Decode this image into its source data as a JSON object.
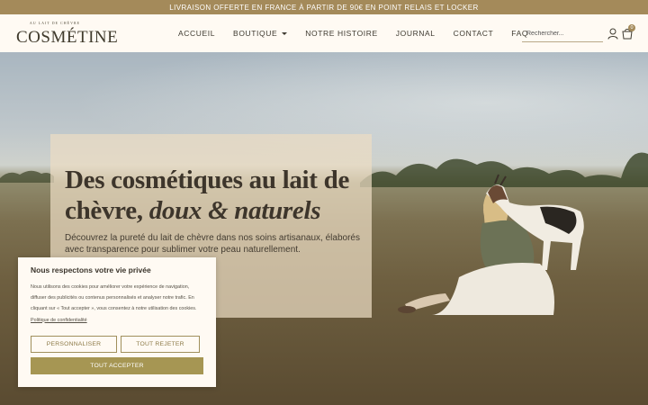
{
  "promo": {
    "text": "LIVRAISON OFFERTE EN FRANCE À PARTIR DE 90€ EN POINT RELAIS ET LOCKER"
  },
  "header": {
    "logo_tagline": "AU LAIT DE CHÈVRE",
    "logo_name": "COSMÉTINE",
    "nav": [
      {
        "label": "ACCUEIL"
      },
      {
        "label": "BOUTIQUE"
      },
      {
        "label": "NOTRE HISTOIRE"
      },
      {
        "label": "JOURNAL"
      },
      {
        "label": "CONTACT"
      },
      {
        "label": "FAQ"
      }
    ],
    "search_placeholder": "Rechercher...",
    "cart_count": "0"
  },
  "hero": {
    "title_line1": "Des cosmétiques au lait de",
    "title_line2_plain": "chèvre, ",
    "title_line2_italic": "doux & naturels",
    "subtitle": "Découvrez la pureté du lait de chèvre dans nos soins artisanaux, élaborés avec transparence pour sublimer votre peau naturellement."
  },
  "cookie": {
    "title": "Nous respectons votre vie privée",
    "text": "Nous utilisons des cookies pour améliorer votre expérience de navigation, diffuser des publicités ou contenus personnalisés et analyser notre trafic. En cliquant sur « Tout accepter », vous consentez à notre utilisation des cookies. ",
    "link": "Politique de confidentialité",
    "btn_customize": "PERSONNALISER",
    "btn_reject": "TOUT REJETER",
    "btn_accept": "TOUT ACCEPTER"
  },
  "colors": {
    "promo_bg": "#a48a5a",
    "header_bg": "#fffaf3",
    "accent": "#a69653",
    "text_dark": "#3d352b"
  },
  "icons": [
    "user-icon",
    "shopping-bag-icon",
    "caret-down-icon"
  ]
}
